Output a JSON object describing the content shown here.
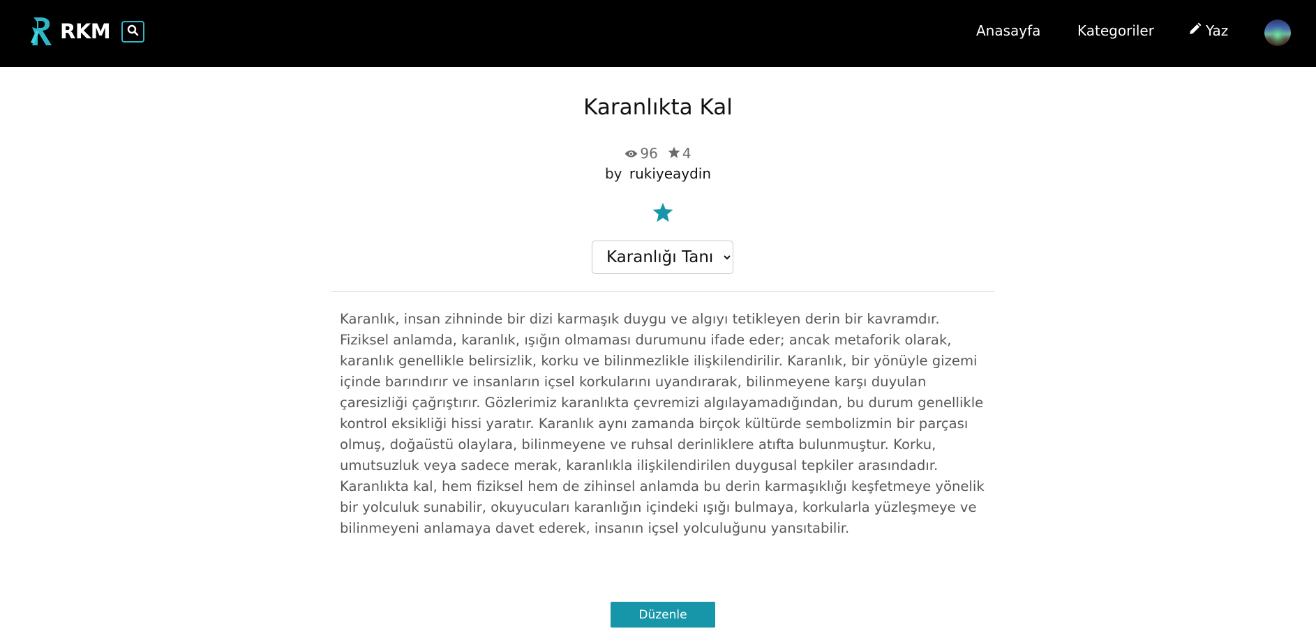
{
  "navbar": {
    "brand": "RKM",
    "links": {
      "home": "Anasayfa",
      "categories": "Kategoriler",
      "write": "Yaz"
    },
    "icons": {
      "brand": "rkm-logo-icon",
      "search": "search-icon",
      "write": "pencil-icon",
      "avatar": "user-avatar"
    },
    "accent": "#2fb7c9"
  },
  "story": {
    "title": "Karanlıkta Kal",
    "views": "96",
    "rating": "4",
    "by_label": "by",
    "author": "rukiyeaydin",
    "favorite_icon": "star-icon",
    "favorite_color": "#1696a8",
    "chapter_select": {
      "selected": "Karanlığı Tanı"
    },
    "body": "Karanlık, insan zihninde bir dizi karmaşık duygu ve algıyı tetikleyen derin bir kavramdır. Fiziksel anlamda, karanlık, ışığın olmaması durumunu ifade eder; ancak metaforik olarak, karanlık genellikle belirsizlik, korku ve bilinmezlikle ilişkilendirilir. Karanlık, bir yönüyle gizemi içinde barındırır ve insanların içsel korkularını uyandırarak, bilinmeyene karşı duyulan çaresizliği çağrıştırır. Gözlerimiz karanlıkta çevremizi algılayamadığından, bu durum genellikle kontrol eksikliği hissi yaratır. Karanlık aynı zamanda birçok kültürde sembolizmin bir parçası olmuş, doğaüstü olaylara, bilinmeyene ve ruhsal derinliklere atıfta bulunmuştur. Korku, umutsuzluk veya sadece merak, karanlıkla ilişkilendirilen duygusal tepkiler arasındadır. Karanlıkta kal, hem fiziksel hem de zihinsel anlamda bu derin karmaşıklığı keşfetmeye yönelik bir yolculuk sunabilir, okuyucuları karanlığın içindeki ışığı bulmaya, korkularla yüzleşmeye ve bilinmeyeni anlamaya davet ederek, insanın içsel yolculuğunu yansıtabilir.",
    "edit_button": "Düzenle"
  }
}
